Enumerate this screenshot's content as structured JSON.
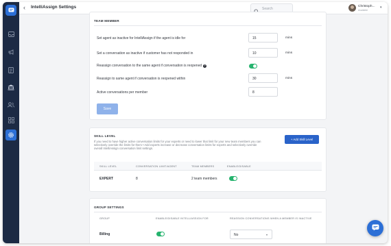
{
  "header": {
    "back_glyph": "‹",
    "title": "IntelliAssign Settings",
    "search_placeholder": "Search",
    "user_name": "Christoph...",
    "user_status": "Available"
  },
  "sidebar": {
    "icons": [
      "inbox-icon",
      "megaphone-icon",
      "document-icon",
      "bank-icon",
      "contacts-icon",
      "grid-icon",
      "settings-icon"
    ],
    "active": "settings-icon"
  },
  "team_member": {
    "title": "TEAM MEMBER",
    "rows": [
      {
        "label": "Set agent as inactive for IntelliAssign if the agent is idle for",
        "value": "15",
        "unit": "mins"
      },
      {
        "label": "Set a conversation as inactive if customer has not responded in",
        "value": "10",
        "unit": "mins"
      },
      {
        "label": "Reassign conversation to the same agent if conversation is reopened",
        "toggle": true
      },
      {
        "label": "Reassign to same agent if conversation is reopened within",
        "value": "30",
        "unit": "mins"
      },
      {
        "label": "Active conversations per member",
        "value": "8"
      }
    ],
    "save_label": "Save"
  },
  "skill_level": {
    "title": "SKILL LEVEL",
    "description": "If you need to have higher active conversation limits for your experts or need to lower that limit for your new team members you can selectively override the limits for them • Add experts increase or decrease conversation limits for experts and selectively override overall IntelliAssign conversation limit settings.",
    "add_label": "+ Add Skill Level",
    "columns": [
      "SKILL LEVEL",
      "CONVERSATION LIMIT/AGENT",
      "TEAM MEMBERS",
      "ENABLE/DISABLE"
    ],
    "rows": [
      {
        "skill": "EXPERT",
        "limit": "8",
        "members": "2 team members",
        "enabled": true
      }
    ]
  },
  "group_settings": {
    "title": "GROUP SETTINGS",
    "columns": [
      "GROUP",
      "ENABLE/DISABLE INTELLIASSIGN FOR",
      "REASSIGN CONVERSATIONS WHEN A MEMBER IS INACTIVE"
    ],
    "rows": [
      {
        "group": "Billing",
        "enabled": true,
        "reassign": "No"
      }
    ]
  },
  "colors": {
    "sidebar": "#1c2a44",
    "accent": "#2c6fd6",
    "toggle_on": "#26b36e",
    "save_disabled": "#8fb2ea"
  }
}
